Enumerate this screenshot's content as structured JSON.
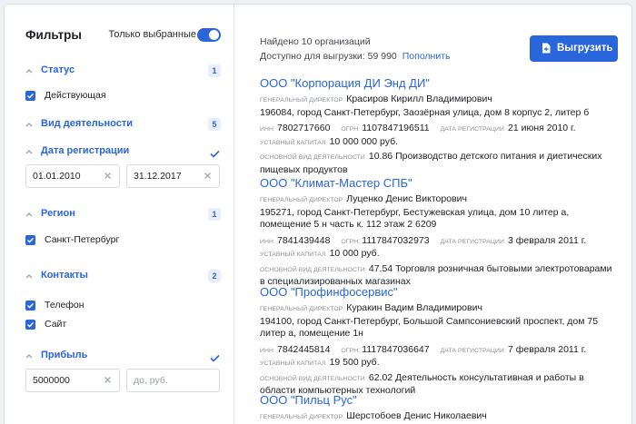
{
  "sidebar": {
    "title": "Фильтры",
    "only_selected_label": "Только выбранные",
    "only_selected_on": true,
    "sections": {
      "status": {
        "label": "Статус",
        "badge": "1",
        "options": [
          "Действующая"
        ]
      },
      "activity": {
        "label": "Вид деятельности",
        "badge": "5"
      },
      "reg_date": {
        "label": "Дата регистрации",
        "from": "01.01.2010",
        "to": "31.12.2017"
      },
      "region": {
        "label": "Регион",
        "badge": "1",
        "options": [
          "Санкт-Петербург"
        ]
      },
      "contacts": {
        "label": "Контакты",
        "badge": "2",
        "options": [
          "Телефон",
          "Сайт"
        ]
      },
      "profit": {
        "label": "Прибыль",
        "from": "5000000",
        "to_placeholder": "до, руб."
      }
    }
  },
  "main": {
    "found_text": "Найдено 10 организаций",
    "available_text": "Доступно для выгрузки: 59 990",
    "replenish_link": "Пополнить",
    "upload_button": "Выгрузить",
    "field_labels": {
      "director": "Генеральный директор",
      "inn": "ИНН",
      "ogrn": "ОГРН",
      "reg_date": "Дата регистрации",
      "capital": "Уставный капитал",
      "main_activity": "Основной вид деятельности"
    },
    "organizations": [
      {
        "name": "ООО \"Корпорация ДИ Энд ДИ\"",
        "director": "Красиров Кирилл Владимирович",
        "address": "196084, город Санкт-Петербург, Заозёрная улица, дом 8 корпус 2, литер б",
        "inn": "7802717660",
        "ogrn": "1107847196511",
        "reg_date": "21 июня 2010 г.",
        "capital": "10 000 000 руб.",
        "activity": "10.86 Производство детского питания и диетических пищевых продуктов"
      },
      {
        "name": "ООО \"Климат-Мастер СПБ\"",
        "director": "Луценко Денис Викторович",
        "address": "195271, город Санкт-Петербург, Бестужевская улица, дом 10 литер а, помещение 5 н часть к. 112 этаж 2 6209",
        "inn": "7841439448",
        "ogrn": "1117847032973",
        "reg_date": "3 февраля 2011 г.",
        "capital": "10 000 руб.",
        "activity": "47.54 Торговля розничная бытовыми электротоварами в специализированных магазинах"
      },
      {
        "name": "ООО \"Профинфосервис\"",
        "director": "Куракин Вадим Владимирович",
        "address": "194100, город Санкт-Петербург, Большой Сампсониевский проспект, дом 75 литер а, помещение 1н",
        "inn": "7842445814",
        "ogrn": "1117847036647",
        "reg_date": "7 февраля 2011 г.",
        "capital": "19 500 руб.",
        "activity": "62.02 Деятельность консультативная и работы в области компьютерных технологий"
      },
      {
        "name": "ООО \"Пильц Рус\"",
        "director": "Шерстобоев Денис Николаевич"
      }
    ]
  }
}
